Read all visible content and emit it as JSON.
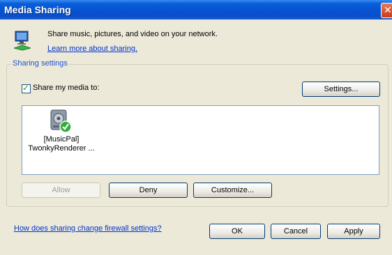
{
  "window": {
    "title": "Media Sharing",
    "close_glyph": "✕"
  },
  "intro": {
    "text": "Share music, pictures, and video on your network.",
    "learn_more": "Learn more about sharing."
  },
  "sharing_settings": {
    "legend": "Sharing settings",
    "share_checkbox_label": "Share my media to:",
    "share_checked": true,
    "settings_button": "Settings...",
    "devices": [
      {
        "line1": "[MusicPal]",
        "line2": "TwonkyRenderer ..."
      }
    ],
    "allow_button": "Allow",
    "deny_button": "Deny",
    "customize_button": "Customize..."
  },
  "footer": {
    "firewall_link": "How does sharing change firewall settings?",
    "ok_button": "OK",
    "cancel_button": "Cancel",
    "apply_button": "Apply"
  },
  "icons": {
    "header": "network-share-icon",
    "device": "media-device-icon",
    "check": "checkmark-icon"
  },
  "colors": {
    "titlebar": "#0652d0",
    "link": "#0033cc",
    "legend": "#1c52d0",
    "window_bg": "#ece9d8"
  }
}
